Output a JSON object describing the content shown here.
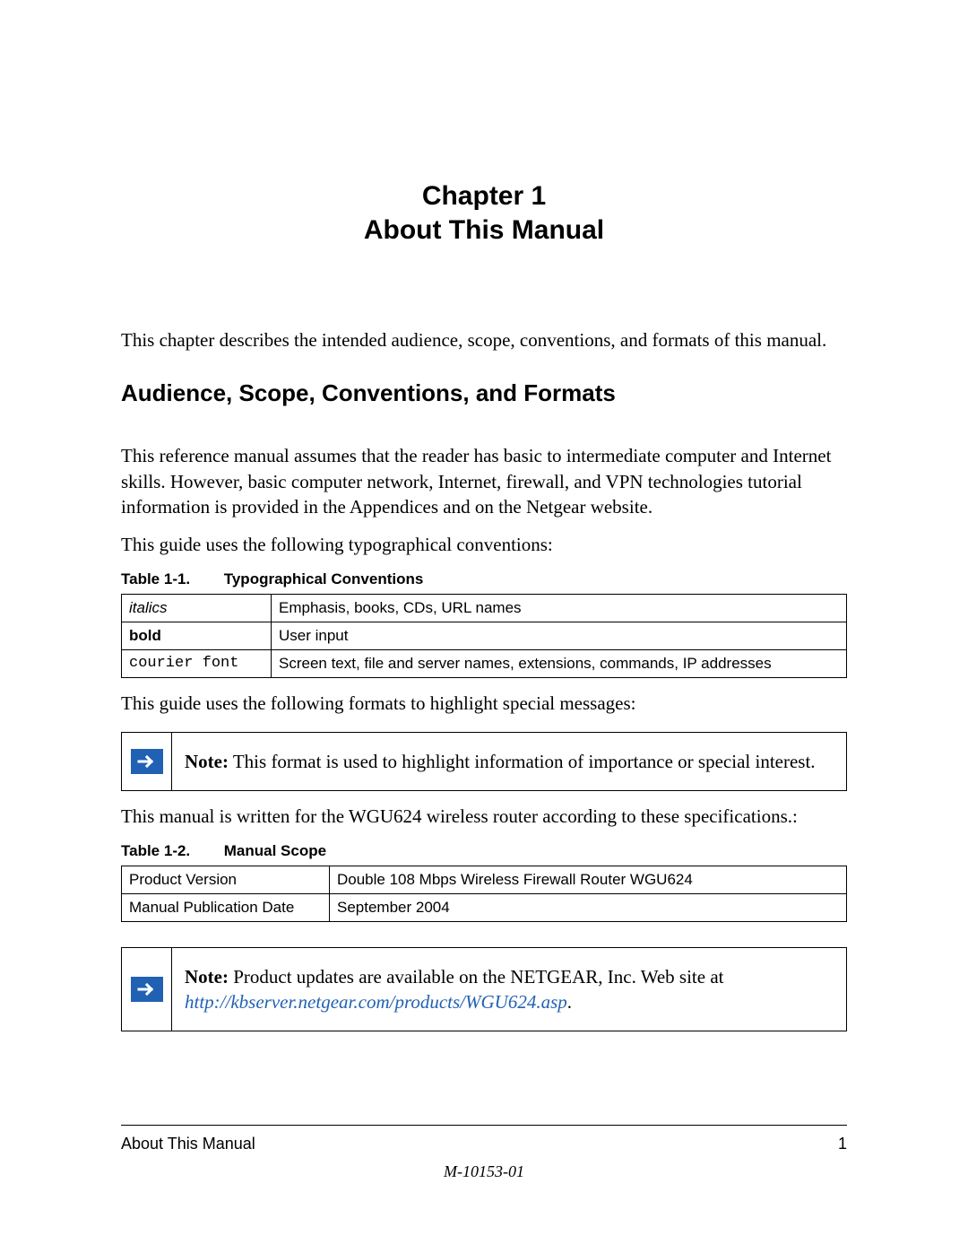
{
  "chapter": {
    "line1": "Chapter 1",
    "line2": "About This Manual"
  },
  "intro": "This chapter describes the intended audience, scope, conventions, and formats of this manual.",
  "section_heading": "Audience, Scope, Conventions, and Formats",
  "para1": "This reference manual assumes that the reader has basic to intermediate computer and Internet skills. However, basic computer network, Internet, firewall, and VPN technologies tutorial information is provided in the Appendices and on the Netgear website.",
  "para2": "This guide uses the following typographical conventions:",
  "table1": {
    "caption_num": "Table 1-1.",
    "caption_title": "Typographical Conventions",
    "rows": [
      {
        "label": "italics",
        "desc": "Emphasis, books, CDs, URL names",
        "style": "italics"
      },
      {
        "label": "bold",
        "desc": "User input",
        "style": "bold"
      },
      {
        "label": "courier font",
        "desc": "Screen text, file and server names, extensions, commands, IP addresses",
        "style": "mono"
      }
    ]
  },
  "para3": "This guide uses the following formats to highlight special messages:",
  "note1": {
    "label": "Note:",
    "text": " This format is used to highlight information of importance or special interest."
  },
  "para4": "This manual is written for the WGU624 wireless router according to these specifications.:",
  "table2": {
    "caption_num": "Table 1-2.",
    "caption_title": "Manual Scope",
    "rows": [
      {
        "label": "Product Version",
        "desc": "Double 108 Mbps Wireless Firewall Router WGU624"
      },
      {
        "label": "Manual Publication Date",
        "desc": "September 2004"
      }
    ]
  },
  "note2": {
    "label": "Note:",
    "text": " Product updates are available on the NETGEAR, Inc. Web site at ",
    "link": "http://kbserver.netgear.com/products/WGU624.asp",
    "suffix": "."
  },
  "footer": {
    "left": "About This Manual",
    "right": "1",
    "id": "M-10153-01"
  }
}
